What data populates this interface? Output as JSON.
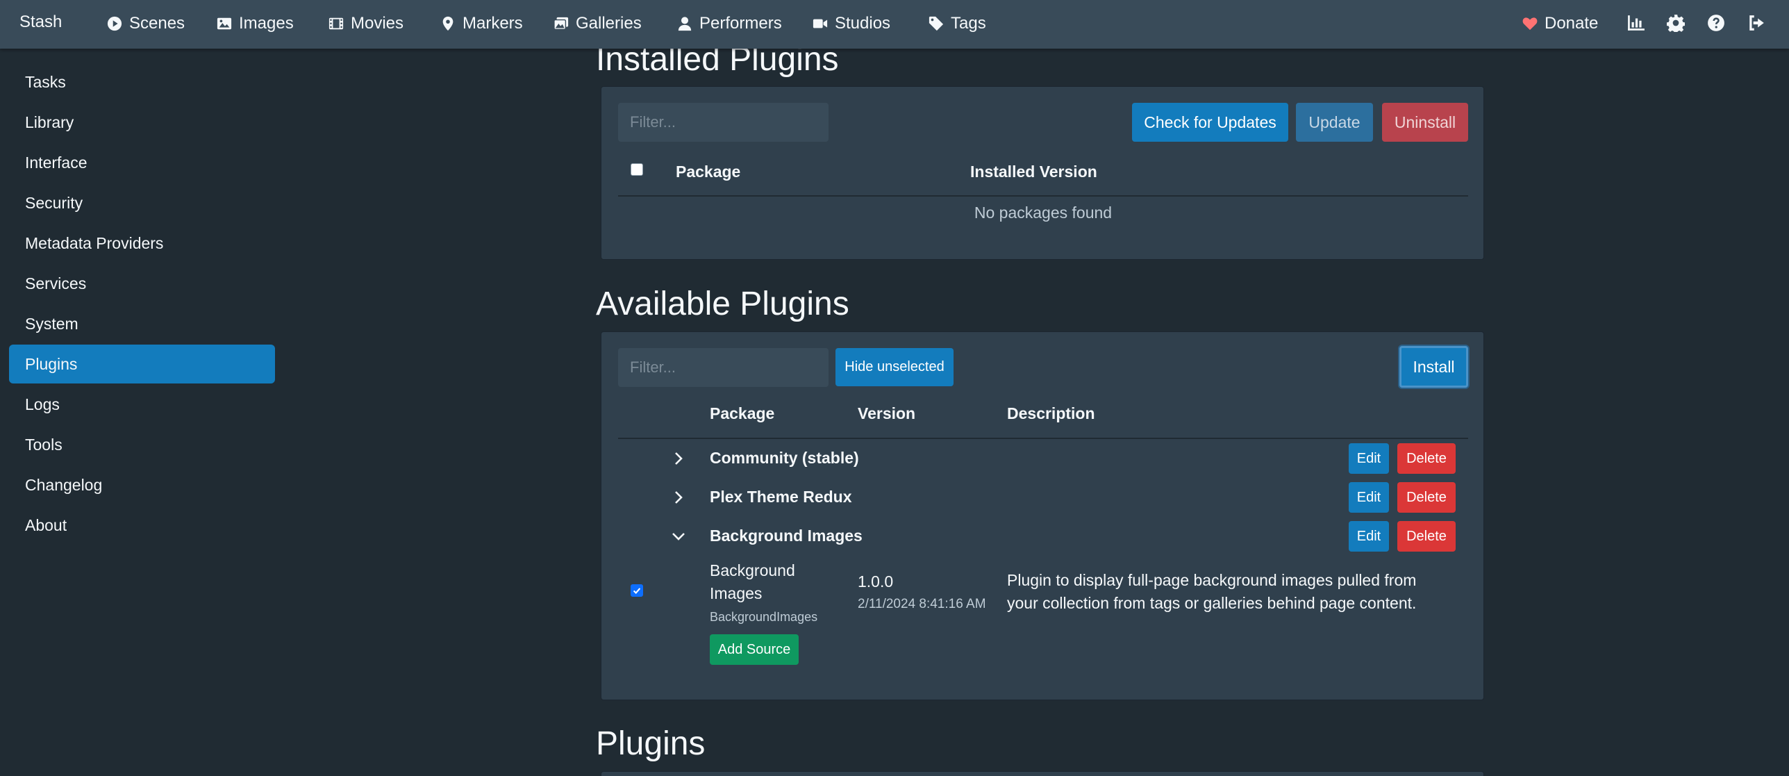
{
  "navbar": {
    "brand": "Stash",
    "items": [
      {
        "label": "Scenes",
        "icon": "play-circle-icon"
      },
      {
        "label": "Images",
        "icon": "image-icon"
      },
      {
        "label": "Movies",
        "icon": "film-icon"
      },
      {
        "label": "Markers",
        "icon": "map-marker-icon"
      },
      {
        "label": "Galleries",
        "icon": "images-icon"
      },
      {
        "label": "Performers",
        "icon": "user-icon"
      },
      {
        "label": "Studios",
        "icon": "video-icon"
      },
      {
        "label": "Tags",
        "icon": "tag-icon"
      }
    ],
    "donate": "Donate",
    "right_icons": [
      "chart-icon",
      "gear-icon",
      "help-icon",
      "logout-icon"
    ]
  },
  "sidebar": {
    "items": [
      {
        "label": "Tasks"
      },
      {
        "label": "Library"
      },
      {
        "label": "Interface"
      },
      {
        "label": "Security"
      },
      {
        "label": "Metadata Providers"
      },
      {
        "label": "Services"
      },
      {
        "label": "System"
      },
      {
        "label": "Plugins",
        "active": true
      },
      {
        "label": "Logs"
      },
      {
        "label": "Tools"
      },
      {
        "label": "Changelog"
      },
      {
        "label": "About"
      }
    ]
  },
  "installed": {
    "title": "Installed Plugins",
    "filter_placeholder": "Filter...",
    "check_updates": "Check for Updates",
    "update": "Update",
    "uninstall": "Uninstall",
    "col_package": "Package",
    "col_installed_version": "Installed Version",
    "empty": "No packages found"
  },
  "available": {
    "title": "Available Plugins",
    "filter_placeholder": "Filter...",
    "hide_unselected": "Hide unselected",
    "install": "Install",
    "col_package": "Package",
    "col_version": "Version",
    "col_description": "Description",
    "sources": [
      {
        "name": "Community (stable)",
        "expanded": false,
        "edit": "Edit",
        "delete": "Delete"
      },
      {
        "name": "Plex Theme Redux",
        "expanded": false,
        "edit": "Edit",
        "delete": "Delete"
      },
      {
        "name": "Background Images",
        "expanded": true,
        "edit": "Edit",
        "delete": "Delete"
      }
    ],
    "package": {
      "checked": true,
      "name_line1": "Background",
      "name_line2": "Images",
      "id": "BackgroundImages",
      "version": "1.0.0",
      "date": "2/11/2024 8:41:16 AM",
      "desc_line1": "Plugin to display full-page background images pulled from",
      "desc_line2": "your collection from tags or galleries behind page content."
    },
    "add_source": "Add Source"
  },
  "plugins": {
    "title": "Plugins"
  },
  "colors": {
    "navbar": "#394b59",
    "background": "#202b33",
    "card": "#30404d",
    "primary": "#137cbd",
    "danger": "#db3737",
    "success": "#0f9960",
    "donate_heart": "#ff7373"
  }
}
